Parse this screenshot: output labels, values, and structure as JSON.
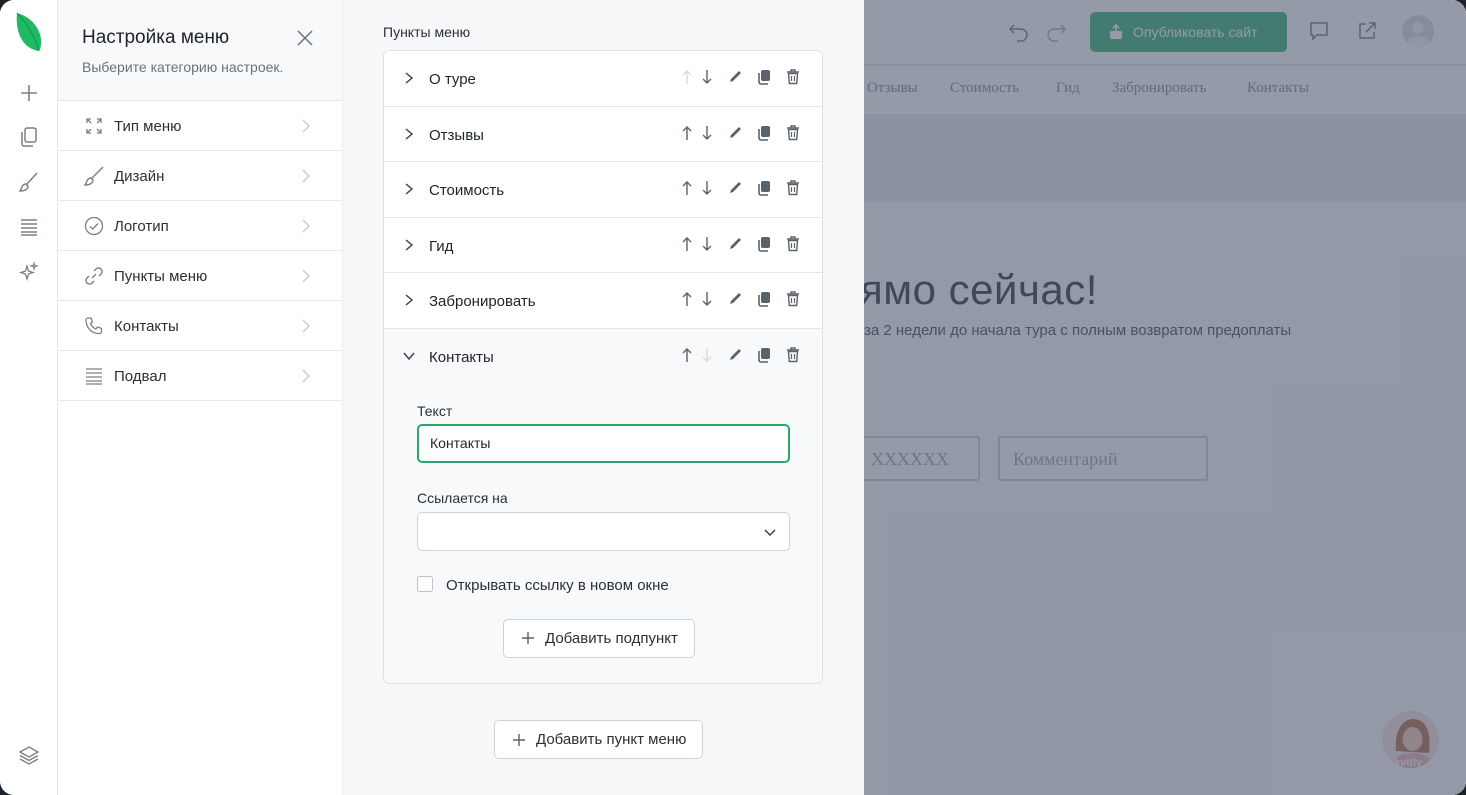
{
  "rail": {
    "icons": [
      "leaf-logo",
      "plus-icon",
      "pages-icon",
      "brush-icon",
      "sections-icon",
      "sparkle-icon",
      "layers-icon"
    ]
  },
  "panel": {
    "title": "Настройка меню",
    "subtitle": "Выберите категорию настроек.",
    "categories": [
      {
        "label": "Тип меню",
        "icon": "expand-icon"
      },
      {
        "label": "Дизайн",
        "icon": "brush-icon"
      },
      {
        "label": "Логотип",
        "icon": "check-circle-icon"
      },
      {
        "label": "Пункты меню",
        "icon": "link-icon"
      },
      {
        "label": "Контакты",
        "icon": "phone-icon"
      },
      {
        "label": "Подвал",
        "icon": "footer-icon"
      }
    ]
  },
  "editor": {
    "title": "Пункты меню",
    "items": [
      {
        "label": "О туре"
      },
      {
        "label": "Отзывы"
      },
      {
        "label": "Стоимость"
      },
      {
        "label": "Гид"
      },
      {
        "label": "Забронировать"
      },
      {
        "label": "Контакты"
      }
    ],
    "expanded": {
      "text_label": "Текст",
      "text_value": "Контакты",
      "link_label": "Ссылается на",
      "link_value": "",
      "new_window_label": "Открывать ссылку в новом окне",
      "new_window_checked": false,
      "add_subitem_label": "Добавить подпункт"
    },
    "add_item_label": "Добавить пункт меню"
  },
  "preview": {
    "publish_label": "Опубликовать сайт",
    "nav": [
      "Отзывы",
      "Стоимость",
      "Гид",
      "Забронировать",
      "Контакты"
    ],
    "heading": "ямо сейчас!",
    "paragraph": "за 2 недели до начала тура с полным возвратом предоплаты",
    "phone_placeholder": "XXXXXX",
    "comment_placeholder": "Комментарий",
    "chat_label": "kvitly"
  },
  "colors": {
    "accent": "#28a86a",
    "publish": "#2cae6e",
    "overlay": "#525c72"
  }
}
